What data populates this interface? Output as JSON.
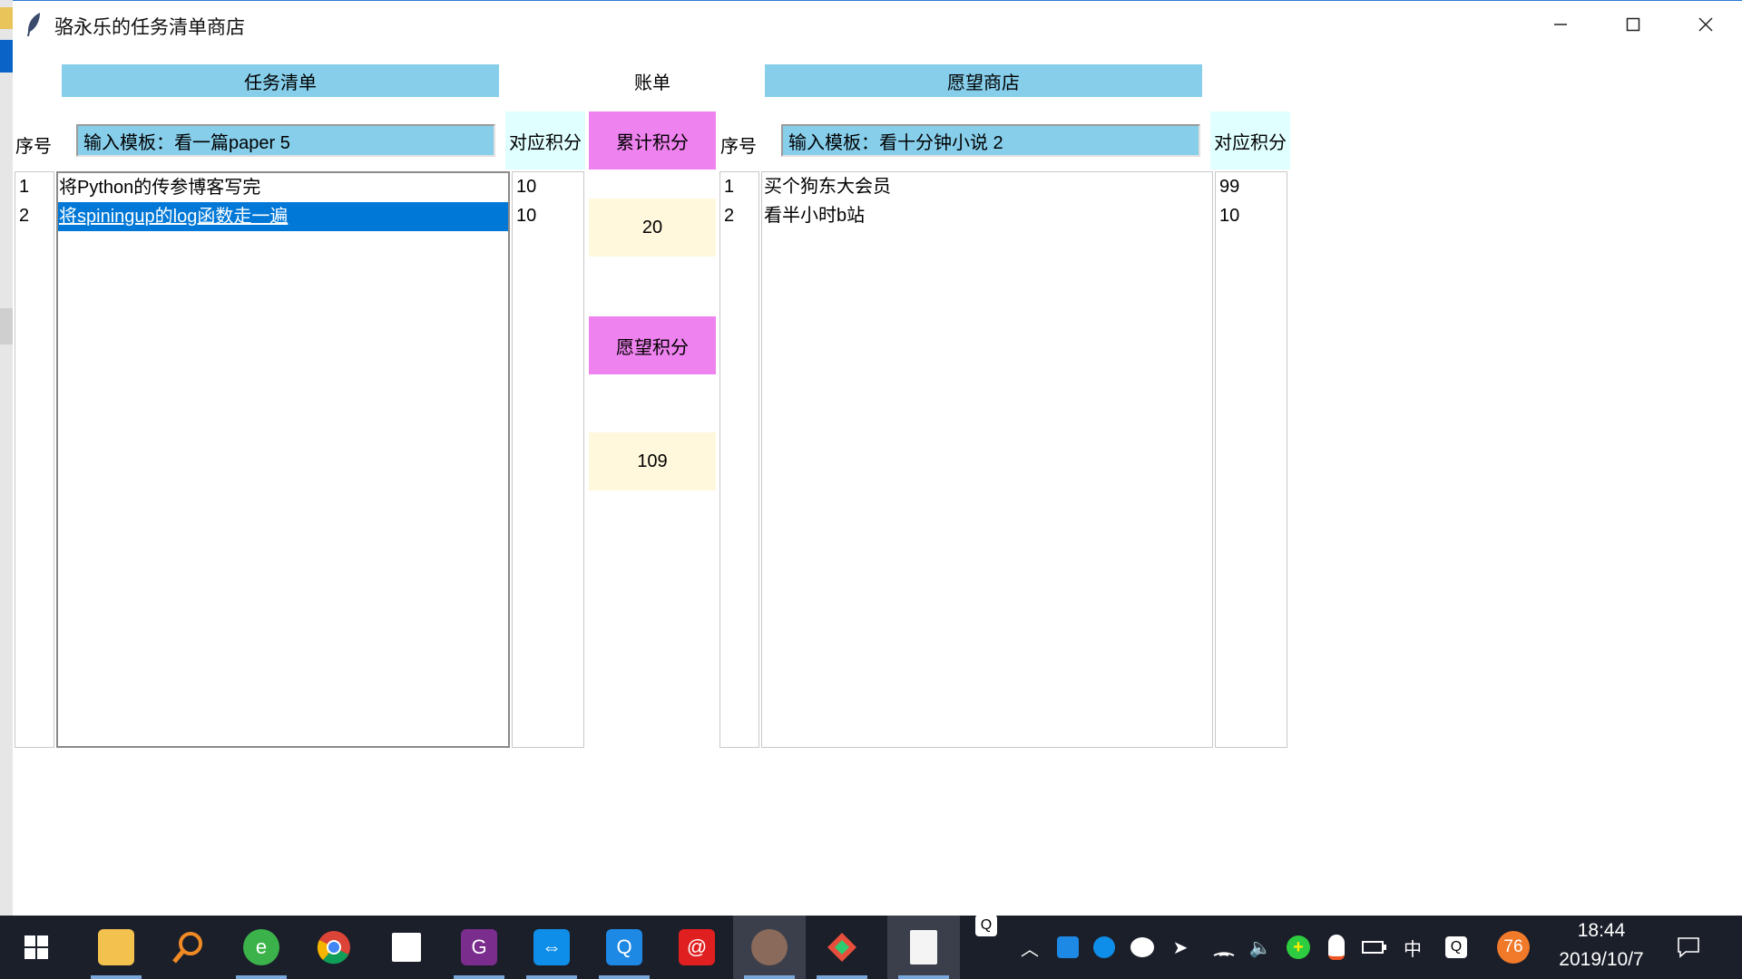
{
  "window": {
    "title": "骆永乐的任务清单商店",
    "minimize_icon": "—",
    "maximize_icon": "☐",
    "close_icon": "✕"
  },
  "tasks": {
    "header": "任务清单",
    "index_label": "序号",
    "input_value": "输入模板：看一篇paper 5",
    "score_label": "对应积分",
    "items": [
      {
        "index": "1",
        "name": "将Python的传参博客写完",
        "score": "10"
      },
      {
        "index": "2",
        "name": "将spiningup的log函数走一遍",
        "score": "10",
        "selected": true
      }
    ]
  },
  "bill": {
    "header": "账单",
    "accumulated_label": "累计积分",
    "accumulated_value": "20",
    "wish_label": "愿望积分",
    "wish_value": "109"
  },
  "shop": {
    "header": "愿望商店",
    "index_label": "序号",
    "input_value": "输入模板：看十分钟小说 2",
    "score_label": "对应积分",
    "items": [
      {
        "index": "1",
        "name": "买个狗东大会员",
        "score": "99"
      },
      {
        "index": "2",
        "name": "看半小时b站",
        "score": "10"
      }
    ]
  },
  "taskbar": {
    "apps": [
      "windows-start",
      "file-explorer",
      "search",
      "ie-browser",
      "chrome",
      "sticky-notes",
      "pdf-editor",
      "teamviewer",
      "dictionary",
      "netease-music",
      "avatar-app",
      "git-app",
      "blank-document"
    ],
    "ime": "中",
    "battery_badge": "76",
    "time": "18:44",
    "date": "2019/10/7"
  },
  "colors": {
    "header_blue": "#87ceeb",
    "pink": "#ee82ee",
    "cream": "#fff8dc",
    "light_cyan": "#e0ffff",
    "selection": "#0078d7",
    "taskbar": "#1b1f2a"
  }
}
